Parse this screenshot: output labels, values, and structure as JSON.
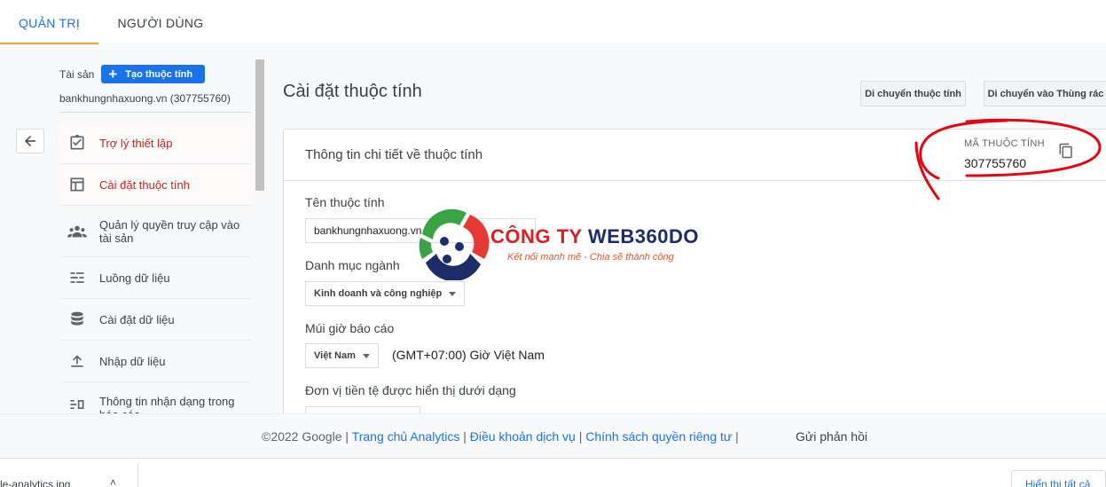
{
  "tabs": [
    {
      "label": "QUẢN TRỊ",
      "active": true
    },
    {
      "label": "NGƯỜI DÙNG",
      "active": false
    }
  ],
  "sidebar": {
    "property_label": "Tài sản",
    "create_button": "Tạo thuộc tính",
    "property_name": "bankhungnhaxuong.vn (307755760)",
    "items": [
      {
        "label": "Trợ lý thiết lập",
        "icon": "checklist-icon",
        "highlighted": true
      },
      {
        "label": "Cài đặt thuộc tính",
        "icon": "property-settings-icon",
        "highlighted": true
      },
      {
        "label": "Quản lý quyền truy cập vào tài sản",
        "icon": "people-icon",
        "highlighted": false
      },
      {
        "label": "Luồng dữ liệu",
        "icon": "data-streams-icon",
        "highlighted": false
      },
      {
        "label": "Cài đặt dữ liệu",
        "icon": "database-icon",
        "highlighted": false
      },
      {
        "label": "Nhập dữ liệu",
        "icon": "upload-icon",
        "highlighted": false
      },
      {
        "label": "Thông tin nhận dạng trong báo cáo",
        "icon": "reporting-identity-icon",
        "highlighted": false
      }
    ]
  },
  "header": {
    "title": "Cài đặt thuộc tính",
    "move_button": "Di chuyển thuộc tính",
    "trash_button": "Di chuyển vào Thùng rác"
  },
  "card": {
    "title": "Thông tin chi tiết về thuộc tính",
    "id_label": "MÃ THUỘC TÍNH",
    "id_value": "307755760",
    "name_label": "Tên thuộc tính",
    "name_value": "bankhungnhaxuong.vn",
    "industry_label": "Danh mục ngành",
    "industry_value": "Kinh doanh và công nghiệp",
    "timezone_label": "Múi giờ báo cáo",
    "timezone_country": "Việt Nam",
    "timezone_value": "(GMT+07:00) Giờ Việt Nam",
    "currency_label": "Đơn vị tiền tệ được hiển thị dưới dạng"
  },
  "watermark": {
    "title_red": "CÔNG TY ",
    "title_blue": "WEB360DO",
    "subtitle": "Kết nối mạnh mẽ - Chia sẽ thành công"
  },
  "footer": {
    "copyright": "©2022 Google",
    "link_home": "Trang chủ Analytics",
    "link_terms": "Điều khoản dịch vụ",
    "link_privacy": "Chính sách quyền riêng tư",
    "feedback": "Gửi phản hồi"
  },
  "downloads": {
    "file_name": "le-analytics.jpg",
    "show_all": "Hiển thị tất cả"
  },
  "colors": {
    "accent_blue": "#1a73e8",
    "highlight_red": "#c5221f",
    "tab_underline": "#e8a33d",
    "annotation_red": "#e30613"
  }
}
